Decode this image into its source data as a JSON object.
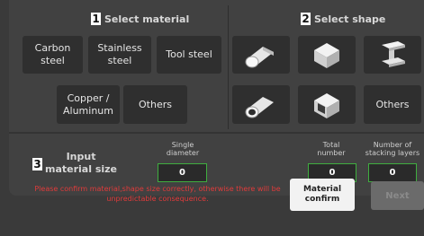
{
  "material_section": {
    "number": "1",
    "title": "Select material",
    "buttons": [
      "Carbon steel",
      "Stainless steel",
      "Tool steel",
      "Copper / Aluminum",
      "Others"
    ]
  },
  "shape_section": {
    "number": "2",
    "title": "Select shape",
    "others_label": "Others"
  },
  "size_section": {
    "number": "3",
    "title_line1": "Input",
    "title_line2": "material size",
    "single_diameter": {
      "label": "Single diameter",
      "value": "0"
    },
    "total_number": {
      "label": "Total number",
      "value": "0"
    },
    "stacking_layers": {
      "label": "Number of stacking layers",
      "value": "0"
    }
  },
  "footer": {
    "warning": "Please confirm material,shape size correctly, otherwise there will be unpredictable consequence.",
    "confirm_button": "Material confirm",
    "next_button": "Next"
  },
  "colors": {
    "accent_field_border": "#3fae3f",
    "warning_text": "#e03b3b"
  }
}
